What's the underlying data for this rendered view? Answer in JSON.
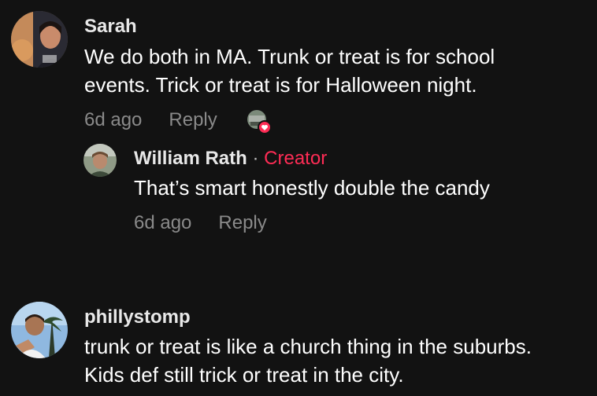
{
  "comments": [
    {
      "username": "Sarah",
      "text_lines": [
        "We do both in MA. Trunk or treat is for school",
        "events. Trick or treat is for Halloween night."
      ],
      "time": "6d ago",
      "reply_label": "Reply",
      "reply": {
        "username": "William Rath",
        "separator": "·",
        "badge": "Creator",
        "text": "That’s smart honestly double the candy",
        "time": "6d ago",
        "reply_label": "Reply"
      }
    },
    {
      "username": "phillystomp",
      "text_lines": [
        "trunk or treat is like a church thing in the suburbs.",
        "Kids def still trick or treat in the city."
      ]
    }
  ],
  "colors": {
    "background": "#121212",
    "creator_accent": "#fe2c55",
    "muted": "#8a8a8a"
  }
}
